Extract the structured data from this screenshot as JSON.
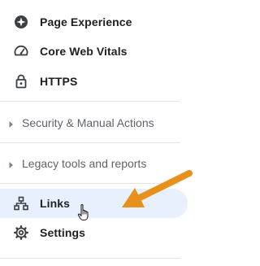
{
  "nav": {
    "items": [
      {
        "label": "Page Experience",
        "icon": "page-experience-icon"
      },
      {
        "label": "Core Web Vitals",
        "icon": "speedometer-icon"
      },
      {
        "label": "HTTPS",
        "icon": "lock-icon"
      }
    ],
    "sections": [
      {
        "label": "Security & Manual Actions",
        "icon": "caret-right-icon"
      },
      {
        "label": "Legacy tools and reports",
        "icon": "caret-right-icon"
      }
    ],
    "links": {
      "label": "Links",
      "icon": "links-icon"
    },
    "settings": {
      "label": "Settings",
      "icon": "gear-icon"
    }
  },
  "colors": {
    "selected_bg": "#e8f0fe",
    "arrow": "#e8901c",
    "icon": "#3c4043",
    "text": "#202124",
    "section_text": "#5f6368"
  }
}
